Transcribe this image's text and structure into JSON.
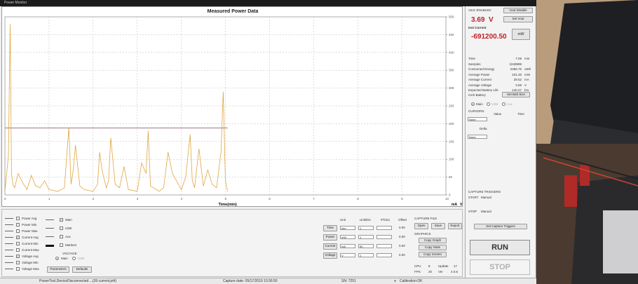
{
  "window": {
    "title": "Power Monitor"
  },
  "chart_data": {
    "type": "line",
    "title": "Measured Power Data",
    "xlabel": "Time(min)",
    "ylabel": "mA",
    "ylim": [
      0,
      500
    ],
    "xlim": [
      0,
      10
    ],
    "y_ticks": [
      "0",
      "50",
      "100",
      "150",
      "200",
      "250",
      "300",
      "350",
      "400",
      "450",
      "500"
    ],
    "x_ticks": [
      "0",
      "1",
      "2",
      "3",
      "4",
      "5",
      "6",
      "7",
      "8",
      "9",
      "10"
    ],
    "x_unit_label": "mA",
    "x_unit_axis": "V",
    "series": [
      {
        "color": "#e0a640",
        "x": [
          0,
          0.08,
          0.12,
          0.15,
          0.18,
          0.22,
          0.3,
          0.4,
          0.5,
          0.6,
          0.7,
          0.8,
          0.9,
          1.0,
          1.2,
          1.35,
          1.45,
          1.5,
          1.55,
          1.6,
          1.7,
          1.8,
          2.0,
          2.1,
          2.15,
          2.2,
          2.3,
          2.35,
          2.4,
          2.5,
          2.6,
          2.7,
          2.8,
          3.0,
          3.1,
          3.2,
          3.25,
          3.3,
          3.5,
          3.6,
          3.7,
          3.8,
          4.0,
          4.1,
          4.2,
          4.25,
          4.3,
          4.4,
          4.5,
          4.6,
          4.7,
          4.8,
          4.9,
          4.95,
          5.0,
          5.05
        ],
        "y": [
          10,
          110,
          480,
          60,
          30,
          20,
          60,
          35,
          15,
          55,
          25,
          20,
          40,
          15,
          10,
          20,
          190,
          30,
          70,
          140,
          25,
          15,
          10,
          30,
          120,
          70,
          20,
          40,
          160,
          30,
          20,
          80,
          15,
          10,
          90,
          60,
          180,
          25,
          10,
          20,
          120,
          60,
          15,
          50,
          170,
          40,
          20,
          130,
          25,
          70,
          30,
          20,
          120,
          290,
          40,
          10
        ]
      }
    ],
    "threshold": {
      "y": 188,
      "x_end": 5.05,
      "color": "#7a4a6a"
    },
    "grid": true
  },
  "right_panel": {
    "vout_label": "Vout: ENABLED",
    "vout_disable": "Vout Disable",
    "voltage_value": "3.69",
    "voltage_unit": "V",
    "set_vout": "Set Vout",
    "current_label": "Inst Current",
    "current_value": "-691200.50",
    "current_unit": "mW",
    "stats": [
      {
        "k": "Time",
        "v": "7.09",
        "u": "min"
      },
      {
        "k": "Samples",
        "v": "2249999",
        "u": ""
      },
      {
        "k": "Consumed Energy",
        "v": "2456.75",
        "u": "uWh"
      },
      {
        "k": "Average Power",
        "v": "101.26",
        "u": "mW"
      },
      {
        "k": "Average Current",
        "v": "28.52",
        "u": "mA"
      },
      {
        "k": "Average Voltage",
        "v": "3.69",
        "u": "V"
      },
      {
        "k": "Expected Battery Life",
        "v": "140.27",
        "u": "hrs"
      }
    ],
    "battery_label": "mAh Battery",
    "set_batt_size": "Set Batt Size",
    "channels": [
      "Main",
      "USB",
      "Aux"
    ],
    "cursors": "CURSORS",
    "col_value": "Value",
    "col_time": "Time",
    "none1": "None",
    "delta": "Delta",
    "none2": "None",
    "capture_triggers": "CAPTURE TRIGGERS",
    "start_label": "START",
    "start_value": "Manual",
    "stop_label": "STOP",
    "stop_value": "Manual",
    "set_capture": "Set Capture Triggers",
    "run": "RUN",
    "stop": "STOP"
  },
  "bottom_panel": {
    "legend": [
      "Power Avg",
      "Power Min",
      "Power Max",
      "Current Avg",
      "Current Min",
      "Current Max",
      "Voltage Avg",
      "Voltage Min",
      "Voltage Max"
    ],
    "legend_checked": [
      false,
      false,
      false,
      true,
      false,
      false,
      true,
      false,
      false
    ],
    "ch": [
      "Main",
      "USB",
      "Aux",
      "Markers"
    ],
    "voltage": "VOLTAGE",
    "vmain": "Main",
    "vusb": "USB",
    "parameters": "Parameters",
    "defaults": "Defaults",
    "table_headers": [
      "Unit",
      "Unit/Div",
      "#Ticks",
      "Offset"
    ],
    "rows": [
      {
        "name": "Time",
        "unit": "min",
        "div": "1",
        "offset": "0.00"
      },
      {
        "name": "Power",
        "unit": "mW",
        "div": "1",
        "offset": "0.00"
      },
      {
        "name": "Current",
        "unit": "mA",
        "div": "50",
        "offset": "0.00"
      },
      {
        "name": "Voltage",
        "unit": "V",
        "div": "1",
        "offset": "0.00"
      }
    ],
    "capture_file": "CAPTURE FILE",
    "open": "Open",
    "save": "Save",
    "export": "Export",
    "graphics": "GRAPHICS",
    "copy_graph": "Copy Graph",
    "copy_stats": "Copy Stats",
    "copy_screen": "Copy Screen",
    "cpu_label": "CPU",
    "cpu_val": "8",
    "update_label": "Update",
    "update_val": "17",
    "fps_label": "FPS",
    "fps_val": "20",
    "ver_label": "Ver",
    "ver_val": "4.0.6"
  },
  "status": {
    "left": "PowerTool.DeviceDisconnected ...(39 current.pt4)",
    "mid": "Capture date: 05/17/2019 10:36:50",
    "sn": "SN: 7251",
    "cal": "Calibration:OK"
  }
}
